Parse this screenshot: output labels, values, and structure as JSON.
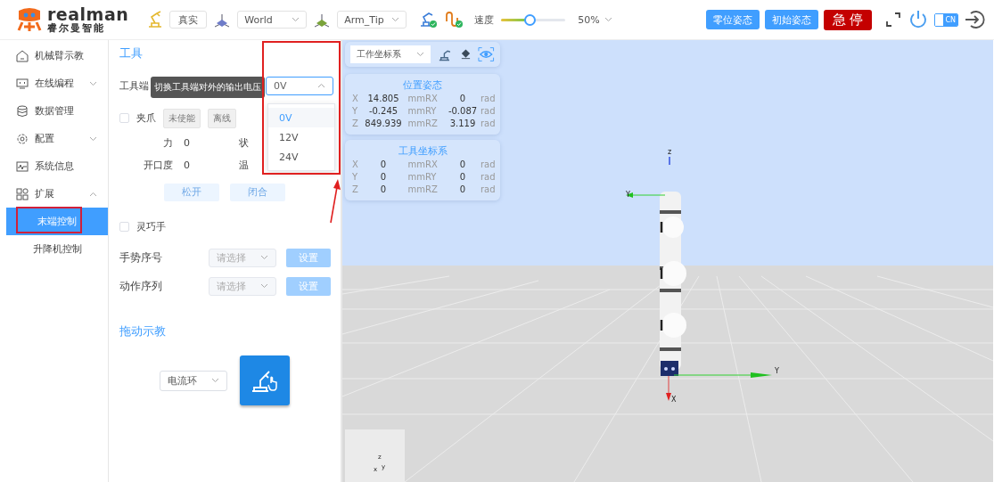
{
  "header": {
    "brand": {
      "name": "realman",
      "subtitle": "睿尔曼智能"
    },
    "mode_select": {
      "value": "真实"
    },
    "frame_select": {
      "value": "World"
    },
    "tool_select": {
      "value": "Arm_Tip"
    },
    "speed": {
      "label": "速度",
      "level": 0.45,
      "value": "50%"
    },
    "buttons": [
      {
        "label": "零位姿态",
        "kind": "primary"
      },
      {
        "label": "初始姿态",
        "kind": "primary"
      },
      {
        "label": "急 停",
        "kind": "danger"
      }
    ],
    "language": {
      "label": "CN"
    }
  },
  "sidebar": {
    "items": [
      {
        "label": "机械臂示教",
        "selected": false
      },
      {
        "label": "在线编程",
        "selected": false,
        "expanded": false
      },
      {
        "label": "数据管理",
        "selected": false
      },
      {
        "label": "配置",
        "selected": false,
        "expanded": false
      },
      {
        "label": "系统信息",
        "selected": false
      },
      {
        "label": "扩展",
        "selected": false,
        "expanded": true,
        "children": [
          {
            "label": "末端控制",
            "selected": true
          },
          {
            "label": "升降机控制",
            "selected": false
          }
        ]
      }
    ]
  },
  "tool_panel": {
    "title": "工具",
    "voltage": {
      "label": "工具端",
      "tooltip": "切换工具端对外的输出电压",
      "value": "0V",
      "expanded": true,
      "options": [
        {
          "label": "0V",
          "selected": true
        },
        {
          "label": "12V",
          "selected": false
        },
        {
          "label": "24V",
          "selected": false
        }
      ]
    },
    "gripper": {
      "label": "夹爪",
      "checked": false,
      "tags": [
        "未使能",
        "离线"
      ],
      "fields": [
        {
          "label": "力",
          "value": "0",
          "status_label": "状"
        },
        {
          "label": "开口度",
          "value": "0",
          "status_label": "温"
        }
      ],
      "buttons": [
        {
          "label": "松开",
          "disabled": true
        },
        {
          "label": "闭合",
          "disabled": true
        }
      ]
    },
    "dexterous_hand": {
      "label": "灵巧手",
      "checked": false
    },
    "settings": [
      {
        "label": "手势序号",
        "placeholder": "请选择",
        "button": "设置",
        "disabled": true
      },
      {
        "label": "动作序列",
        "placeholder": "请选择",
        "button": "设置",
        "disabled": true
      }
    ],
    "drag_teach": {
      "title": "拖动示教",
      "mode": "电流环"
    }
  },
  "viewer": {
    "frame_select": {
      "value": "工作坐标系"
    },
    "panels": [
      {
        "title": "位置姿态",
        "rows": [
          {
            "axis": "X",
            "value": "14.805",
            "unit": "mm",
            "r_axis": "RX",
            "r_value": "0",
            "r_unit": "rad"
          },
          {
            "axis": "Y",
            "value": "-0.245",
            "unit": "mm",
            "r_axis": "RY",
            "r_value": "-0.087",
            "r_unit": "rad"
          },
          {
            "axis": "Z",
            "value": "849.939",
            "unit": "mm",
            "r_axis": "RZ",
            "r_value": "3.119",
            "r_unit": "rad"
          }
        ]
      },
      {
        "title": "工具坐标系",
        "rows": [
          {
            "axis": "X",
            "value": "0",
            "unit": "mm",
            "r_axis": "RX",
            "r_value": "0",
            "r_unit": "rad"
          },
          {
            "axis": "Y",
            "value": "0",
            "unit": "mm",
            "r_axis": "RY",
            "r_value": "0",
            "r_unit": "rad"
          },
          {
            "axis": "Z",
            "value": "0",
            "unit": "mm",
            "r_axis": "RZ",
            "r_value": "0",
            "r_unit": "rad"
          }
        ]
      }
    ],
    "scene_labels": [
      "z",
      "Y",
      "Y",
      "X"
    ],
    "mini_axes_labels": [
      "z",
      "x",
      "y"
    ]
  }
}
